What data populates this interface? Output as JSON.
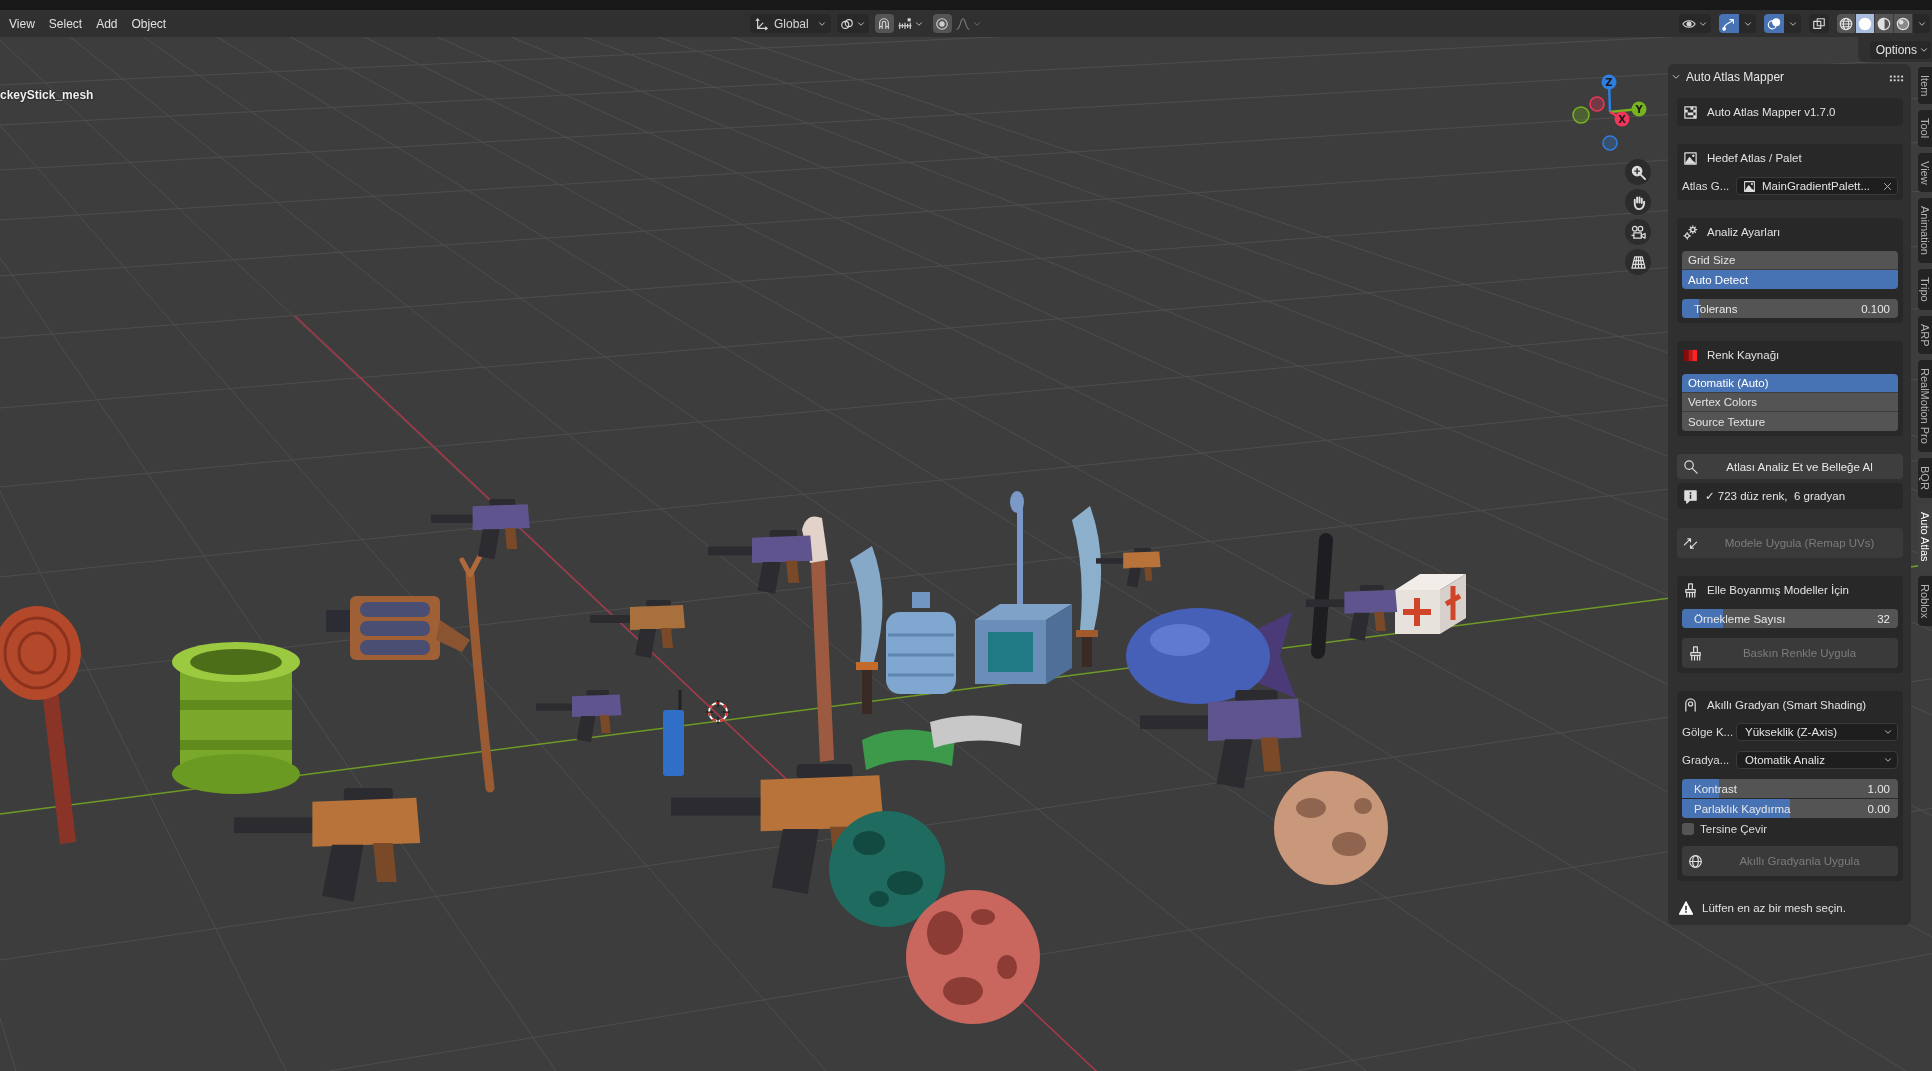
{
  "header": {
    "menus": [
      "View",
      "Select",
      "Add",
      "Object"
    ],
    "orientation": "Global",
    "snapping": {
      "on": false
    },
    "proportional_editing": {
      "on": false
    },
    "viewport_toggles": [
      {
        "kind": "gizmos",
        "on": true
      },
      {
        "kind": "overlays",
        "on": true
      },
      {
        "kind": "xray",
        "on": false
      }
    ],
    "shading_modes": [
      {
        "kind": "wireframe",
        "selected": false
      },
      {
        "kind": "solid",
        "selected": true
      },
      {
        "kind": "material",
        "selected": false
      },
      {
        "kind": "rendered",
        "selected": false
      }
    ]
  },
  "viewport": {
    "object_name": "ckeyStick_mesh",
    "options_button": "Options",
    "navigation_gizmo": {
      "axes": [
        {
          "label": "Z",
          "color": "#2f7fe0"
        },
        {
          "label": "Y",
          "color": "#78b41e"
        },
        {
          "label": "X",
          "color": "#f2365a"
        }
      ]
    }
  },
  "sidebar": {
    "panel": {
      "title": "Auto Atlas Mapper",
      "expanded": true,
      "version_box": "Auto Atlas Mapper v1.7.0",
      "target_atlas": {
        "heading": "Hedef Atlas / Palet",
        "rows": [
          {
            "kind": "image_field",
            "label": "Atlas G...",
            "value": "MainGradientPalett..."
          }
        ]
      },
      "analysis_settings": {
        "heading": "Analiz Ayarları",
        "rows": [
          {
            "kind": "enum",
            "options": [
              {
                "label": "Grid Size",
                "selected": false
              },
              {
                "label": "Auto Detect",
                "selected": true
              }
            ]
          },
          {
            "kind": "slider",
            "label": "Tolerans",
            "value": "0.100",
            "level": 0.08
          }
        ]
      },
      "color_source": {
        "heading": "Renk Kaynağı",
        "rows": [
          {
            "kind": "enum",
            "options": [
              {
                "label": "Otomatik (Auto)",
                "selected": true
              },
              {
                "label": "Vertex Colors",
                "selected": false
              },
              {
                "label": "Source Texture",
                "selected": false
              }
            ]
          }
        ]
      },
      "analyze_button": {
        "label": "Atlası Analiz Et ve Belleğe Al",
        "disabled": false
      },
      "result_info": "✓ 723 düz renk,  6 gradyan",
      "remap_button": {
        "label": "Modele Uygula (Remap UVs)",
        "disabled": true
      },
      "hand_painted": {
        "heading": "Elle Boyanmış Modeller İçin",
        "rows": [
          {
            "kind": "slider",
            "label": "Örnekleme Sayısı",
            "value": "32",
            "level": 0.19
          },
          {
            "kind": "button",
            "label": "Baskın Renkle Uygula",
            "disabled": true
          }
        ]
      },
      "smart_gradient": {
        "heading": "Akıllı Gradyan (Smart Shading)",
        "rows": [
          {
            "kind": "dropdown",
            "label": "Gölge K...",
            "value": "Yükseklik (Z-Axis)"
          },
          {
            "kind": "dropdown",
            "label": "Gradya...",
            "value": "Otomatik Analiz"
          },
          {
            "kind": "slider_stack",
            "sliders": [
              {
                "label": "Kontrast",
                "value": "1.00",
                "level": 0.17
              },
              {
                "label": "Parlaklık Kaydırma",
                "value": "0.00",
                "level": 0.5
              }
            ]
          },
          {
            "kind": "checkbox",
            "label": "Tersine Çevir",
            "checked": false
          },
          {
            "kind": "button",
            "label": "Akıllı Gradyanla Uygula",
            "disabled": true
          }
        ]
      },
      "warning": "Lütfen en az bir mesh seçin."
    },
    "tabs": [
      {
        "label": "Item",
        "selected": false
      },
      {
        "label": "Tool",
        "selected": false
      },
      {
        "label": "View",
        "selected": false
      },
      {
        "label": "Animation",
        "selected": false
      },
      {
        "label": "Tripo",
        "selected": false
      },
      {
        "label": "ARP",
        "selected": false
      },
      {
        "label": "RealMotion Pro",
        "selected": false
      },
      {
        "label": "BQR",
        "selected": false
      },
      {
        "label": "Auto Atlas",
        "selected": true
      },
      {
        "label": "Roblox",
        "selected": false
      }
    ]
  }
}
